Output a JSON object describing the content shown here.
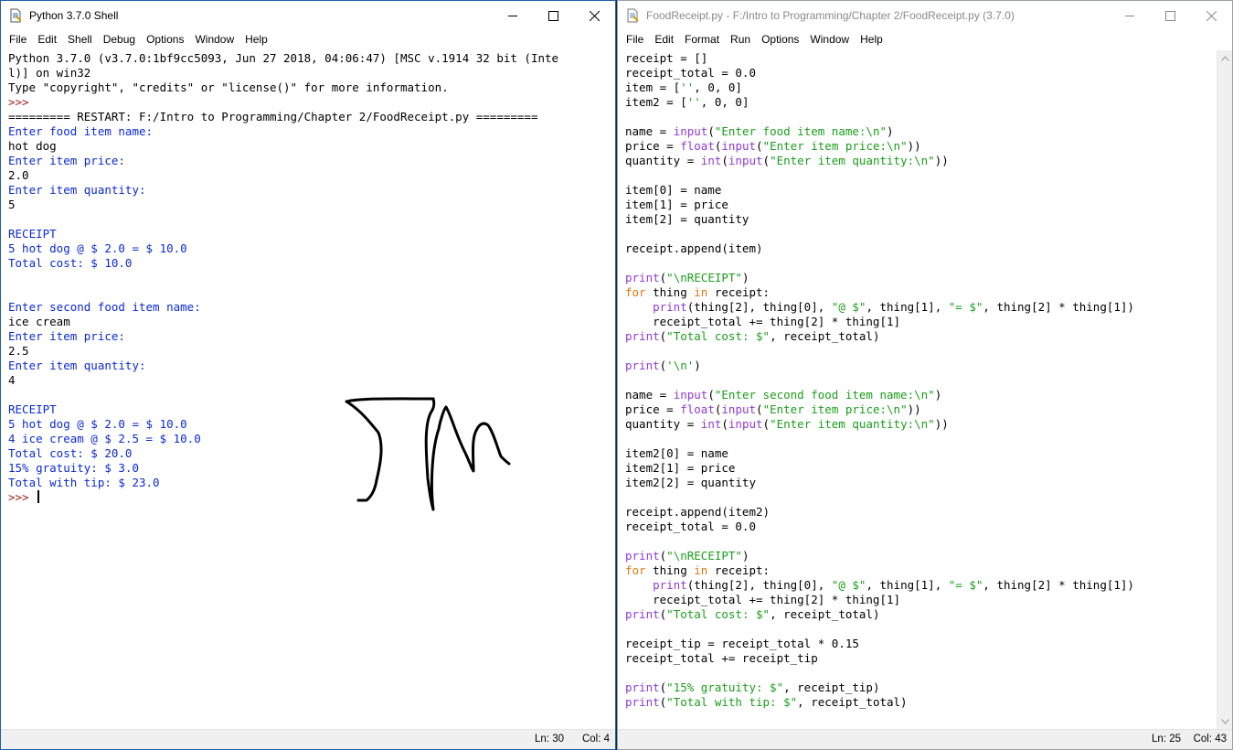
{
  "shell": {
    "title": "Python 3.7.0 Shell",
    "menus": [
      "File",
      "Edit",
      "Shell",
      "Debug",
      "Options",
      "Window",
      "Help"
    ],
    "lines": [
      "Python 3.7.0 (v3.7.0:1bf9cc5093, Jun 27 2018, 04:06:47) [MSC v.1914 32 bit (Inte",
      "l)] on win32",
      "Type \"copyright\", \"credits\" or \"license()\" for more information.",
      ">>> ",
      "========= RESTART: F:/Intro to Programming/Chapter 2/FoodReceipt.py =========",
      "Enter food item name:",
      "hot dog",
      "Enter item price:",
      "2.0",
      "Enter item quantity:",
      "5",
      "",
      "RECEIPT",
      "5 hot dog @ $ 2.0 = $ 10.0",
      "Total cost: $ 10.0",
      "",
      "",
      "Enter second food item name:",
      "ice cream",
      "Enter item price:",
      "2.5",
      "Enter item quantity:",
      "4",
      "",
      "RECEIPT",
      "5 hot dog @ $ 2.0 = $ 10.0",
      "4 ice cream @ $ 2.5 = $ 10.0",
      "Total cost: $ 20.0",
      "15% gratuity: $ 3.0",
      "Total with tip: $ 23.0",
      ">>> "
    ],
    "status": {
      "ln": "Ln: 30",
      "col": "Col: 4"
    }
  },
  "editor": {
    "title": "FoodReceipt.py - F:/Intro to Programming/Chapter 2/FoodReceipt.py (3.7.0)",
    "menus": [
      "File",
      "Edit",
      "Format",
      "Run",
      "Options",
      "Window",
      "Help"
    ],
    "lines": [
      "receipt = []",
      "receipt_total = 0.0",
      "item = ['', 0, 0]",
      "item2 = ['', 0, 0]",
      "",
      "name = input(\"Enter food item name:\\n\")",
      "price = float(input(\"Enter item price:\\n\"))",
      "quantity = int(input(\"Enter item quantity:\\n\"))",
      "",
      "item[0] = name",
      "item[1] = price",
      "item[2] = quantity",
      "",
      "receipt.append(item)",
      "",
      "print(\"\\nRECEIPT\")",
      "for thing in receipt:",
      "    print(thing[2], thing[0], \"@ $\", thing[1], \"= $\", thing[2] * thing[1])",
      "    receipt_total += thing[2] * thing[1]",
      "print(\"Total cost: $\", receipt_total)",
      "",
      "print('\\n')",
      "",
      "name = input(\"Enter second food item name:\\n\")",
      "price = float(input(\"Enter item price:\\n\"))",
      "quantity = int(input(\"Enter item quantity:\\n\"))",
      "",
      "item2[0] = name",
      "item2[1] = price",
      "item2[2] = quantity",
      "",
      "receipt.append(item2)",
      "receipt_total = 0.0",
      "",
      "print(\"\\nRECEIPT\")",
      "for thing in receipt:",
      "    print(thing[2], thing[0], \"@ $\", thing[1], \"= $\", thing[2] * thing[1])",
      "    receipt_total += thing[2] * thing[1]",
      "print(\"Total cost: $\", receipt_total)",
      "",
      "receipt_tip = receipt_total * 0.15",
      "receipt_total += receipt_tip",
      "",
      "print(\"15% gratuity: $\", receipt_tip)",
      "print(\"Total with tip: $\", receipt_total)"
    ],
    "status": {
      "ln": "Ln: 25",
      "col": "Col: 43"
    }
  },
  "colors": {
    "output": "#0b2ad4",
    "string": "#1a9e1a",
    "keyword": "#e2780f",
    "builtin": "#8e3bd6",
    "prompt": "#a02020"
  }
}
